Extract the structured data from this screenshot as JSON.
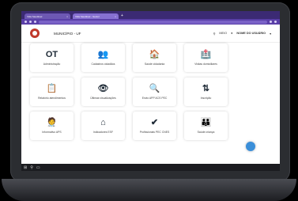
{
  "browser": {
    "tabs": [
      {
        "label": "Vida Saudável",
        "close": "×"
      },
      {
        "label": "Vida Saudável - Gestor",
        "close": "×"
      }
    ],
    "new_tab": "+"
  },
  "header": {
    "municipio": "MUNICÍPIO - UF",
    "search_icon": "search-icon",
    "search_label": "MEIO",
    "user_name": "NOME DO USUÁRIO",
    "user_chevron": "▾"
  },
  "cards": [
    {
      "icon": "OT",
      "label": "Administração"
    },
    {
      "icon": "👥",
      "label": "Cadastros cidadãos"
    },
    {
      "icon": "🏠",
      "label": "Saúde cidadania"
    },
    {
      "icon": "🏥",
      "label": "Visitas domiciliares"
    },
    {
      "icon": "📋",
      "label": "Relatório atendimentos"
    },
    {
      "icon": "👁",
      "label": "Últimas visualizações"
    },
    {
      "icon": "🔍",
      "label": "Envio APP ACS PEC"
    },
    {
      "icon": "⇅",
      "label": "Inscrição"
    },
    {
      "icon": "🧑‍⚕️",
      "label": "Informativo APS"
    },
    {
      "icon": "⌂",
      "label": "Indicadores ESF"
    },
    {
      "icon": "✔",
      "label": "Profissionais PEC CNES"
    },
    {
      "icon": "👪",
      "label": "Saúde criança"
    }
  ],
  "taskbar": {
    "start": "⊞",
    "search": "⚲",
    "apps": "▭"
  },
  "colors": {
    "browser_chrome": "#3b2a73",
    "fab": "#3b8fd9",
    "logo": "#c0392b"
  }
}
